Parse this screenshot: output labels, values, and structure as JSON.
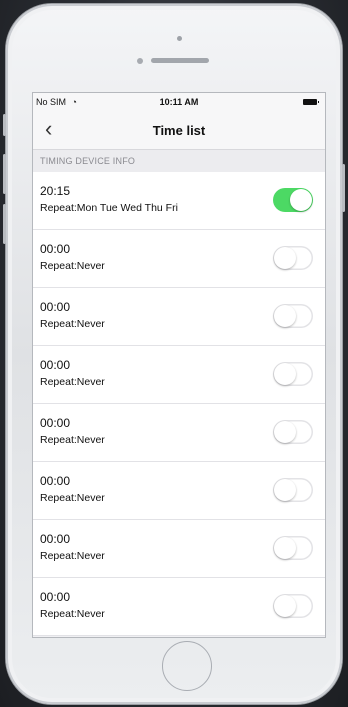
{
  "status_bar": {
    "carrier": "No SIM",
    "wifi_icon": "wifi-icon",
    "time": "10:11 AM",
    "battery_icon": "battery-icon"
  },
  "nav": {
    "back_icon": "chevron-left-icon",
    "back_glyph": "‹",
    "title": "Time list"
  },
  "section_header": "TIMING DEVICE INFO",
  "colors": {
    "toggle_on": "#4cd964",
    "toggle_off": "#ffffff"
  },
  "timers": [
    {
      "time": "20:15",
      "repeat": "Repeat:Mon Tue Wed Thu Fri",
      "enabled": true
    },
    {
      "time": "00:00",
      "repeat": "Repeat:Never",
      "enabled": false
    },
    {
      "time": "00:00",
      "repeat": "Repeat:Never",
      "enabled": false
    },
    {
      "time": "00:00",
      "repeat": "Repeat:Never",
      "enabled": false
    },
    {
      "time": "00:00",
      "repeat": "Repeat:Never",
      "enabled": false
    },
    {
      "time": "00:00",
      "repeat": "Repeat:Never",
      "enabled": false
    },
    {
      "time": "00:00",
      "repeat": "Repeat:Never",
      "enabled": false
    },
    {
      "time": "00:00",
      "repeat": "Repeat:Never",
      "enabled": false
    }
  ]
}
